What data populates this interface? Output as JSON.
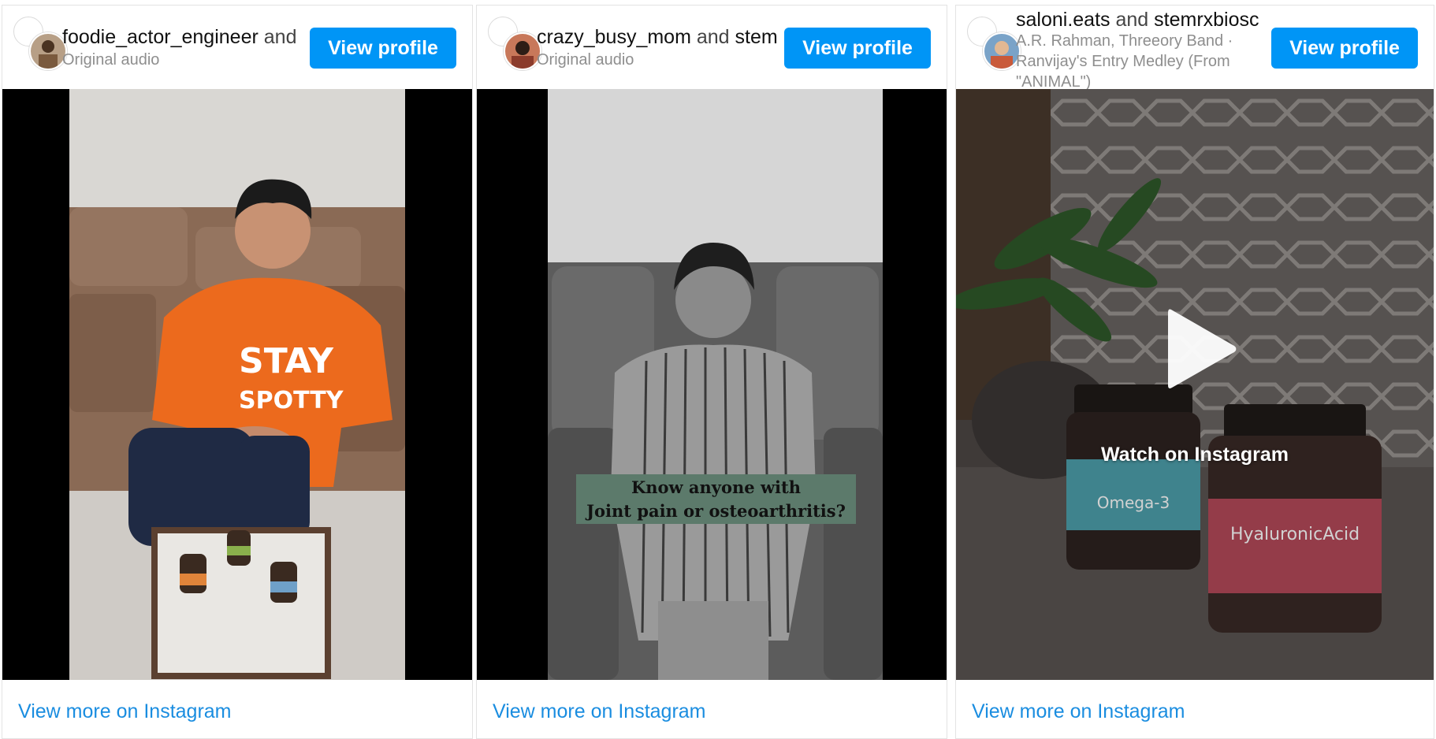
{
  "cards": [
    {
      "username": "foodie_actor_engineer",
      "and_text": "and",
      "collaborator": "",
      "subtitle": "Original audio",
      "view_profile_label": "View profile",
      "view_more_label": "View more on Instagram"
    },
    {
      "username": "crazy_busy_mom",
      "and_text": "and",
      "collaborator": "stem",
      "subtitle": "Original audio",
      "view_profile_label": "View profile",
      "view_more_label": "View more on Instagram",
      "overlay_caption_line1": "Know anyone with",
      "overlay_caption_line2": "Joint pain or osteoarthritis?"
    },
    {
      "username": "saloni.eats",
      "and_text": "and",
      "collaborator": "stemrxbiosc",
      "subtitle": "A.R. Rahman, Threeory Band · Ranvijay's Entry Medley (From \"ANIMAL\")",
      "view_profile_label": "View profile",
      "view_more_label": "View more on Instagram",
      "watch_label": "Watch on Instagram",
      "bottle_labels": [
        "Omega-3",
        "HyaluronicAcid"
      ]
    }
  ],
  "colors": {
    "brand_button": "#0095f6",
    "link": "#1a8de0",
    "caption_bg": "#5c7a6b"
  }
}
